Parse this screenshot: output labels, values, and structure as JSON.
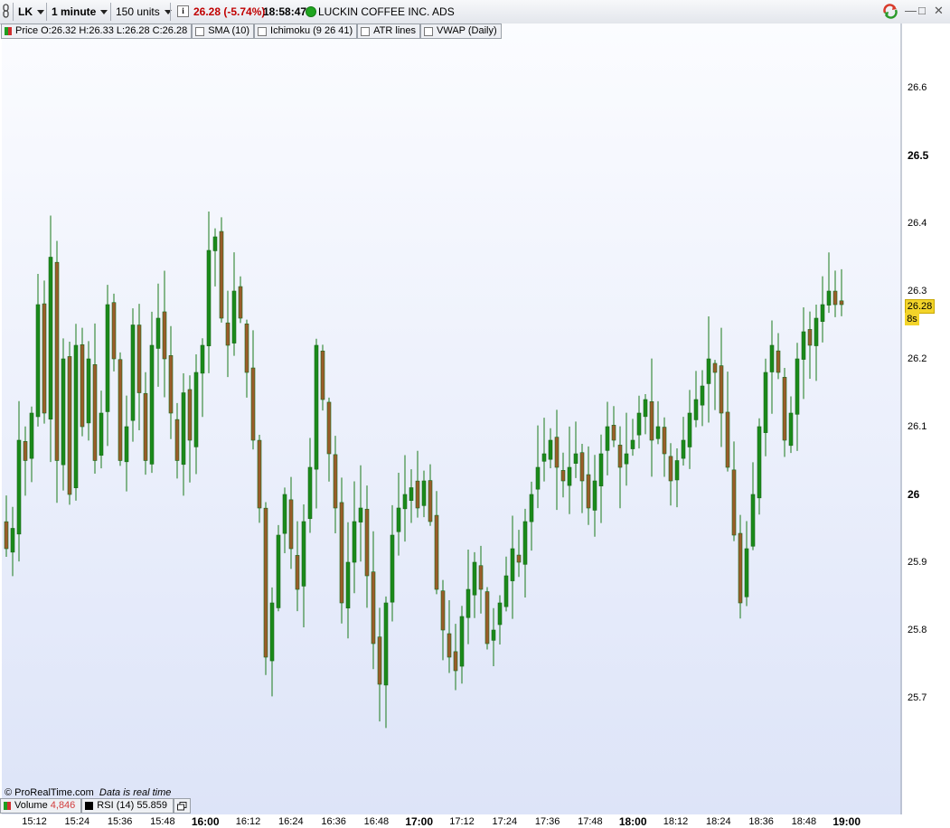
{
  "toolbar": {
    "symbol": "LK",
    "timeframe": "1 minute",
    "units": "150 units",
    "price": "26.28 (-5.74%)",
    "time": "18:58:47",
    "instrument": "LUCKIN COFFEE INC. ADS",
    "info_icon": "i",
    "window_controls": [
      "—",
      "□",
      "✕"
    ]
  },
  "indicators": {
    "price": "Price",
    "ohlc": "O:26.32 H:26.33 L:26.28 C:26.28",
    "sma": "SMA (10)",
    "ichimoku": "Ichimoku (9 26 41)",
    "atr": "ATR lines",
    "vwap": "VWAP (Daily)"
  },
  "bottom_indicators": {
    "volume_label": "Volume",
    "volume_value": "4,846",
    "rsi_label": "RSI (14)",
    "rsi_value": "55.859"
  },
  "footer": {
    "copyright": "© ProRealTime.com",
    "realtime": "Data is real time"
  },
  "price_tag": "26.28",
  "timer_tag": "8s",
  "colors": {
    "up": "#1a8a1a",
    "down": "#9a5c2a",
    "price_tag": "#f3d42a",
    "price_change": "#c00000"
  },
  "chart_data": {
    "type": "candlestick",
    "yticks": [
      {
        "v": 26.6,
        "label": "26.6",
        "major": false
      },
      {
        "v": 26.5,
        "label": "26.5",
        "major": true
      },
      {
        "v": 26.4,
        "label": "26.4",
        "major": false
      },
      {
        "v": 26.3,
        "label": "26.3",
        "major": false
      },
      {
        "v": 26.2,
        "label": "26.2",
        "major": false
      },
      {
        "v": 26.1,
        "label": "26.1",
        "major": false
      },
      {
        "v": 26.0,
        "label": "26",
        "major": true
      },
      {
        "v": 25.9,
        "label": "25.9",
        "major": false
      },
      {
        "v": 25.8,
        "label": "25.8",
        "major": false
      },
      {
        "v": 25.7,
        "label": "25.7",
        "major": false
      }
    ],
    "xticks": [
      {
        "label": "15:12",
        "major": false
      },
      {
        "label": "15:24",
        "major": false
      },
      {
        "label": "15:36",
        "major": false
      },
      {
        "label": "15:48",
        "major": false
      },
      {
        "label": "16:00",
        "major": true
      },
      {
        "label": "16:12",
        "major": false
      },
      {
        "label": "16:24",
        "major": false
      },
      {
        "label": "16:36",
        "major": false
      },
      {
        "label": "16:48",
        "major": false
      },
      {
        "label": "17:00",
        "major": true
      },
      {
        "label": "17:12",
        "major": false
      },
      {
        "label": "17:24",
        "major": false
      },
      {
        "label": "17:36",
        "major": false
      },
      {
        "label": "17:48",
        "major": false
      },
      {
        "label": "18:00",
        "major": true
      },
      {
        "label": "18:12",
        "major": false
      },
      {
        "label": "18:24",
        "major": false
      },
      {
        "label": "18:36",
        "major": false
      },
      {
        "label": "18:48",
        "major": false
      },
      {
        "label": "19:00",
        "major": true
      }
    ],
    "closes": [
      25.92,
      25.95,
      26.08,
      26.05,
      26.12,
      26.28,
      26.12,
      26.35,
      26.05,
      26.2,
      26.0,
      26.22,
      26.1,
      26.2,
      26.05,
      26.12,
      26.28,
      26.2,
      26.05,
      26.1,
      26.25,
      26.15,
      26.05,
      26.22,
      26.26,
      26.2,
      26.12,
      26.05,
      26.15,
      26.08,
      26.18,
      26.22,
      26.36,
      26.38,
      26.26,
      26.22,
      26.3,
      26.26,
      26.18,
      26.08,
      25.98,
      25.76,
      25.84,
      25.94,
      26.0,
      25.92,
      25.86,
      25.96,
      26.04,
      26.22,
      26.14,
      26.06,
      25.98,
      25.84,
      25.9,
      25.96,
      25.98,
      25.88,
      25.78,
      25.72,
      25.84,
      25.94,
      25.98,
      26.0,
      26.01,
      25.98,
      26.02,
      25.96,
      25.86,
      25.8,
      25.76,
      25.74,
      25.82,
      25.86,
      25.9,
      25.86,
      25.78,
      25.8,
      25.84,
      25.88,
      25.92,
      25.9,
      25.96,
      26.0,
      26.04,
      26.06,
      26.08,
      26.04,
      26.02,
      26.04,
      26.06,
      26.02,
      25.98,
      26.02,
      26.06,
      26.1,
      26.08,
      26.04,
      26.06,
      26.08,
      26.12,
      26.14,
      26.08,
      26.1,
      26.06,
      26.02,
      26.05,
      26.08,
      26.12,
      26.14,
      26.16,
      26.2,
      26.18,
      26.12,
      26.04,
      25.94,
      25.84,
      25.92,
      26.0,
      26.1,
      26.18,
      26.22,
      26.18,
      26.08,
      26.12,
      26.2,
      26.24,
      26.22,
      26.26,
      26.28,
      26.3,
      26.28,
      26.28
    ],
    "candles_note": "approximate 1-minute OHLC reading"
  }
}
